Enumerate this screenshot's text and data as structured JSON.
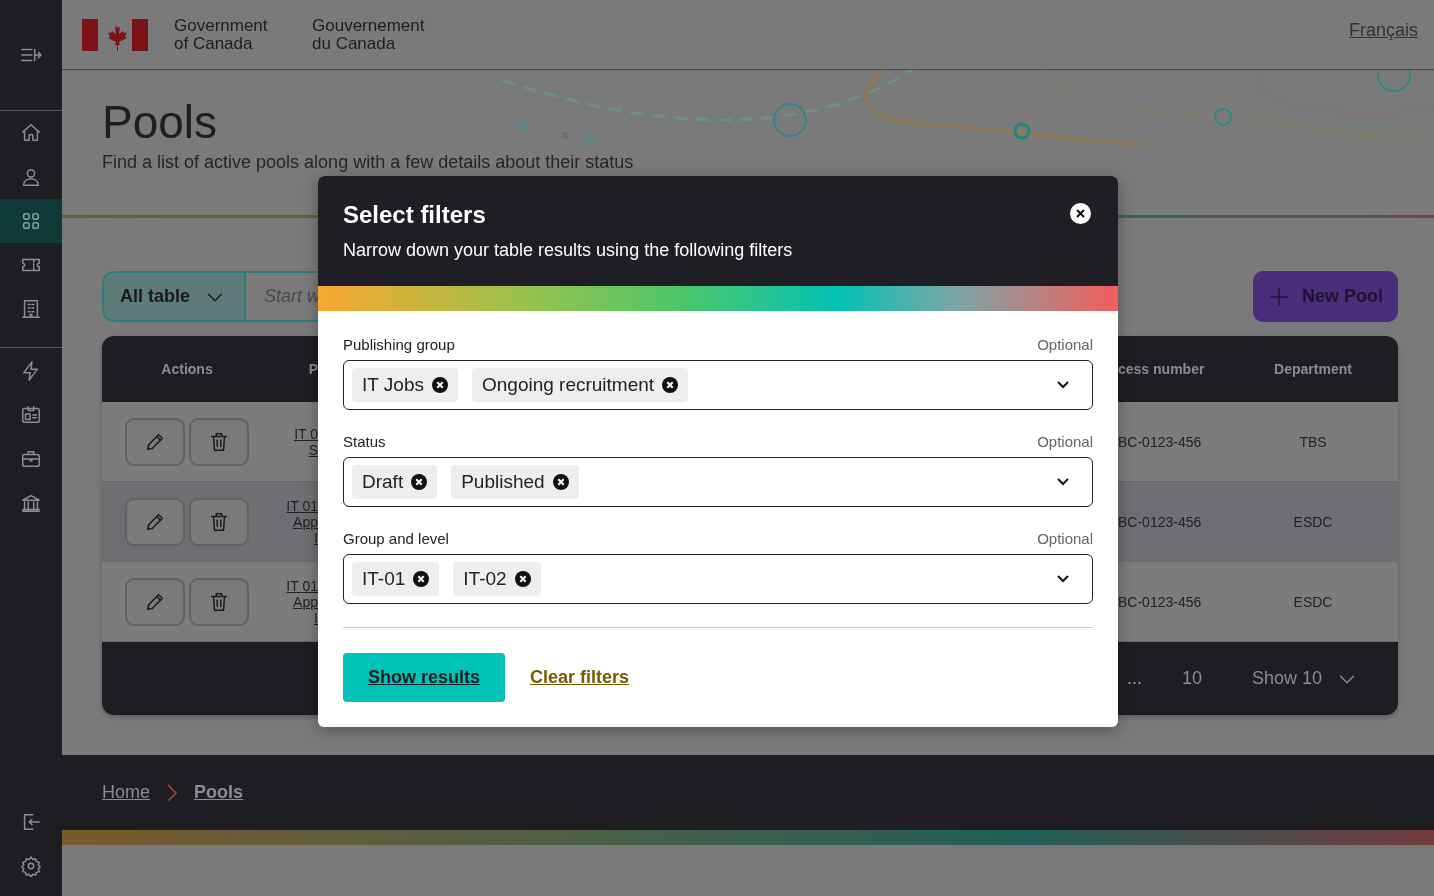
{
  "sidebar": {
    "items": [
      {
        "selected": false
      },
      {
        "selected": false
      },
      {
        "selected": false
      },
      {
        "selected": true
      },
      {
        "selected": false
      },
      {
        "selected": false
      },
      {
        "selected": false
      },
      {
        "selected": false
      },
      {
        "selected": false
      },
      {
        "selected": false
      },
      {
        "selected": false
      },
      {
        "selected": false
      }
    ]
  },
  "header": {
    "name_en": "Government of Canada",
    "name_fr": "Gouvernement du Canada",
    "language_link": "Français"
  },
  "page": {
    "title": "Pools",
    "subtitle": "Find a list of active pools along with a few details about their status"
  },
  "toolbar": {
    "scope": "All table",
    "search": {
      "placeholder": "Start w"
    },
    "new_button": "New Pool"
  },
  "table": {
    "columns": [
      "Actions",
      "P",
      "cess number",
      "Department"
    ],
    "rows": [
      {
        "column_2": "IT 0\nS",
        "process_number": "BC-0123-456",
        "department": "TBS"
      },
      {
        "column_2": "IT 01\nApp\nI",
        "process_number": "BC-0123-456",
        "department": "ESDC"
      },
      {
        "column_2": "IT 01\nApp\nI",
        "process_number": "BC-0123-456",
        "department": "ESDC"
      }
    ],
    "pagination": {
      "ellipsis": "...",
      "page": "10",
      "page_size": "Show 10"
    }
  },
  "breadcrumbs": [
    {
      "label": "Home",
      "current": false
    },
    {
      "label": "Pools",
      "current": true
    }
  ],
  "modal": {
    "title": "Select filters",
    "description": "Narrow down your table results using the following filters",
    "fields": [
      {
        "label": "Publishing group",
        "hint": "Optional",
        "chips": [
          "IT Jobs",
          "Ongoing recruitment"
        ]
      },
      {
        "label": "Status",
        "hint": "Optional",
        "chips": [
          "Draft",
          "Published"
        ]
      },
      {
        "label": "Group and level",
        "hint": "Optional",
        "chips": [
          "IT-01",
          "IT-02"
        ]
      }
    ],
    "primary_button": "Show results",
    "secondary_link": "Clear filters"
  }
}
